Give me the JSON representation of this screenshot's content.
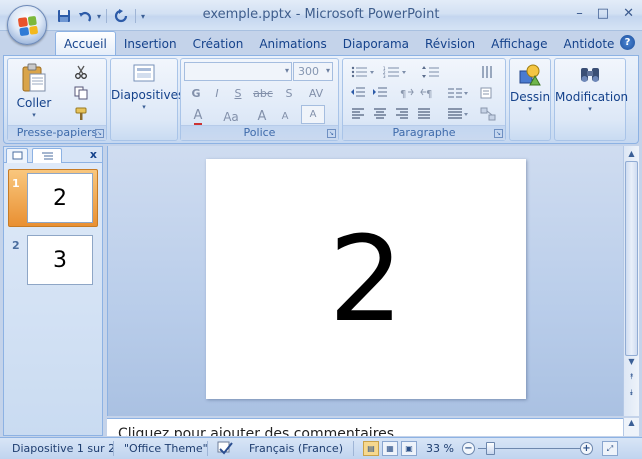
{
  "window": {
    "title": "exemple.pptx - Microsoft PowerPoint",
    "minimize": "–",
    "maximize": "□",
    "close": "✕"
  },
  "quick_access": {
    "save": "💾",
    "undo": "↶",
    "redo": "↻",
    "customize": "▾"
  },
  "tabs": [
    "Accueil",
    "Insertion",
    "Création",
    "Animations",
    "Diaporama",
    "Révision",
    "Affichage",
    "Antidote"
  ],
  "active_tab": "Accueil",
  "help": "?",
  "ribbon": {
    "clipboard": {
      "label": "Presse-papiers",
      "paste_label": "Coller"
    },
    "slides": {
      "label": "Diapositives",
      "new_slide_label": "Diapositives"
    },
    "font": {
      "label": "Police",
      "font_name_value": "",
      "font_size_value": "300",
      "bold": "G",
      "italic": "I",
      "underline": "S",
      "strikethrough": "abc",
      "shadow": "S",
      "spacing": "AV",
      "font_color": "A",
      "change_case": "Aa",
      "grow": "A",
      "shrink": "A",
      "clear": "A"
    },
    "paragraph": {
      "label": "Paragraphe"
    },
    "drawing": {
      "label": "Dessin"
    },
    "editing": {
      "label": "Modification"
    }
  },
  "slides": [
    {
      "number": "1",
      "content": "2"
    },
    {
      "number": "2",
      "content": "3"
    }
  ],
  "current_slide": {
    "content": "2"
  },
  "notes": {
    "placeholder": "Cliquez pour ajouter des commentaires"
  },
  "status": {
    "slide_position": "Diapositive 1 sur 2",
    "theme": "\"Office Theme\"",
    "language": "Français (France)",
    "zoom": "33 %",
    "zoom_level": 0.33
  },
  "colors": {
    "accent": "#15428b",
    "selected_thumb": "#e99032",
    "ribbon_border": "#8db2e3"
  }
}
